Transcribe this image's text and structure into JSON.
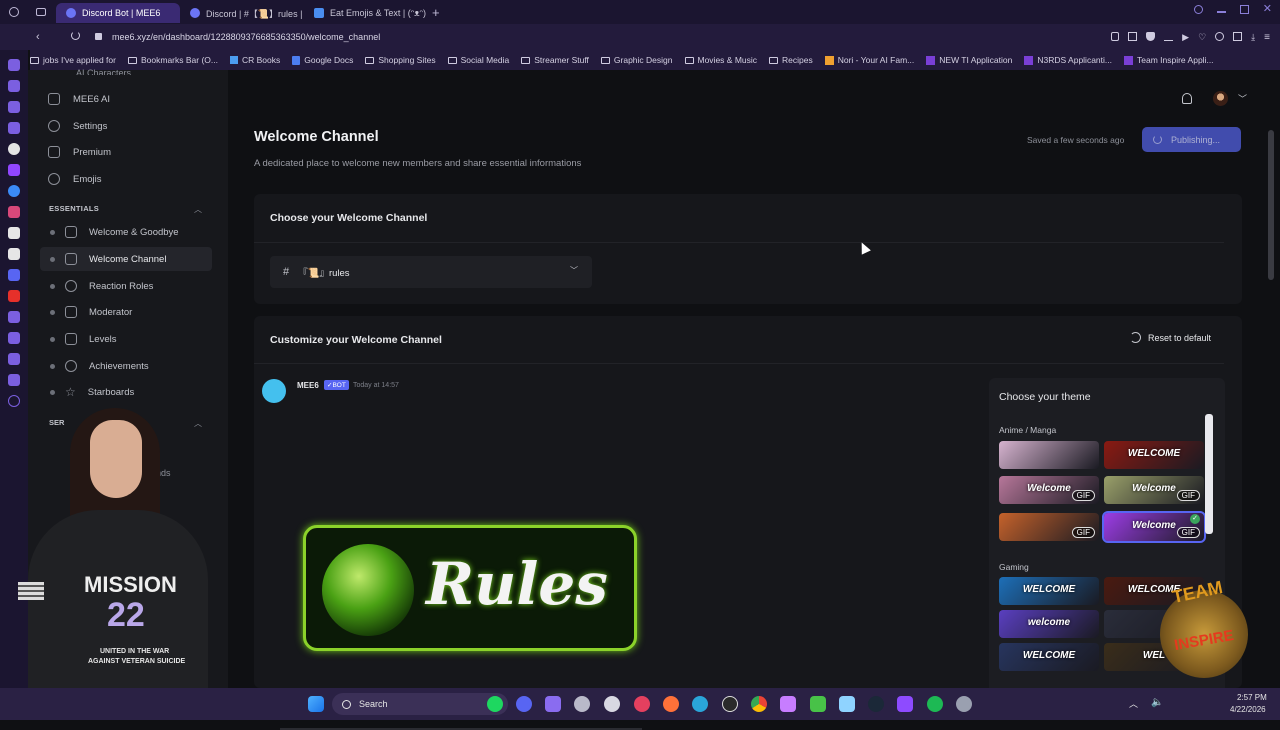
{
  "browser": {
    "tabs": [
      {
        "label": "Discord Bot | MEE6",
        "active": true
      },
      {
        "label": "Discord | #【📜】rules | TE",
        "active": false
      },
      {
        "label": "Eat Emojis & Text | (ᵔᴥᵔ)",
        "active": false
      }
    ],
    "url": "mee6.xyz/en/dashboard/1228809376685363350/welcome_channel",
    "bookmarks": [
      "jobs I've applied for",
      "Bookmarks Bar (O...",
      "CR Books",
      "Google Docs",
      "Shopping Sites",
      "Social Media",
      "Streamer Stuff",
      "Graphic Design",
      "Movies & Music",
      "Recipes",
      "Nori - Your AI Fam...",
      "NEW TI Application",
      "N3RDS Applicanti...",
      "Team Inspire Appli..."
    ]
  },
  "sidebar": {
    "partial_top": "AI Characters",
    "items": [
      {
        "label": "MEE6 AI"
      },
      {
        "label": "Settings"
      },
      {
        "label": "Premium"
      },
      {
        "label": "Emojis"
      }
    ],
    "section_essentials": "ESSENTIALS",
    "essentials": [
      {
        "label": "Welcome & Goodbye"
      },
      {
        "label": "Welcome Channel",
        "active": true
      },
      {
        "label": "Reaction Roles"
      },
      {
        "label": "Moderator"
      },
      {
        "label": "Levels"
      },
      {
        "label": "Achievements"
      },
      {
        "label": "Starboards"
      }
    ],
    "section_partial": "SER",
    "partial_item": "ands"
  },
  "header": {
    "title": "Welcome Channel",
    "subtitle": "A dedicated place to welcome new members and share essential informations",
    "saved_text": "Saved a few seconds ago",
    "publish_label": "Publishing..."
  },
  "choose_channel": {
    "title": "Choose your Welcome Channel",
    "selected_channel": "『📜』rules"
  },
  "customize": {
    "title": "Customize your Welcome Channel",
    "reset_label": "Reset to default",
    "message": {
      "author": "MEE6",
      "badge": "✓BOT",
      "time": "Today at 14:57",
      "banner_text": "Rules"
    }
  },
  "themes": {
    "title": "Choose your theme",
    "group1": "Anime / Manga",
    "group2": "Gaming",
    "tiles": [
      {
        "label": "",
        "gif": false,
        "color": "#d6b3cf"
      },
      {
        "label": "WELCOME",
        "gif": false,
        "color": "#8a1a12"
      },
      {
        "label": "Welcome",
        "gif": true,
        "color": "#b7779a"
      },
      {
        "label": "Welcome",
        "gif": true,
        "color": "#9aa06a"
      },
      {
        "label": "",
        "gif": true,
        "color": "#c5622b"
      },
      {
        "label": "Welcome",
        "gif": true,
        "color": "#9c3de6",
        "selected": true
      },
      {
        "label": "WELCOME",
        "gif": false,
        "color": "#1d6fb8"
      },
      {
        "label": "WELCOME",
        "gif": false,
        "color": "#4a1a10"
      },
      {
        "label": "welcome",
        "gif": false,
        "color": "#5a3fc0"
      },
      {
        "label": "",
        "gif": false,
        "color": "#2a2d3a"
      },
      {
        "label": "WELCOME",
        "gif": false,
        "color": "#27355e"
      },
      {
        "label": "WEL",
        "gif": false,
        "color": "#3a2d1a"
      }
    ]
  },
  "overlay": {
    "shirt_line1": "MISSION",
    "shirt_line2": "22",
    "shirt_line3": "UNITED IN THE WAR",
    "shirt_line4": "AGAINST VETERAN SUICIDE",
    "logo_text1": "TEAM",
    "logo_text2": "INSPIRE"
  },
  "taskbar": {
    "search_label": "Search",
    "time": "2:57 PM",
    "date": "4/22/2026"
  },
  "colors": {
    "accent": "#5865f2",
    "brand_purple": "#3a2a73"
  }
}
